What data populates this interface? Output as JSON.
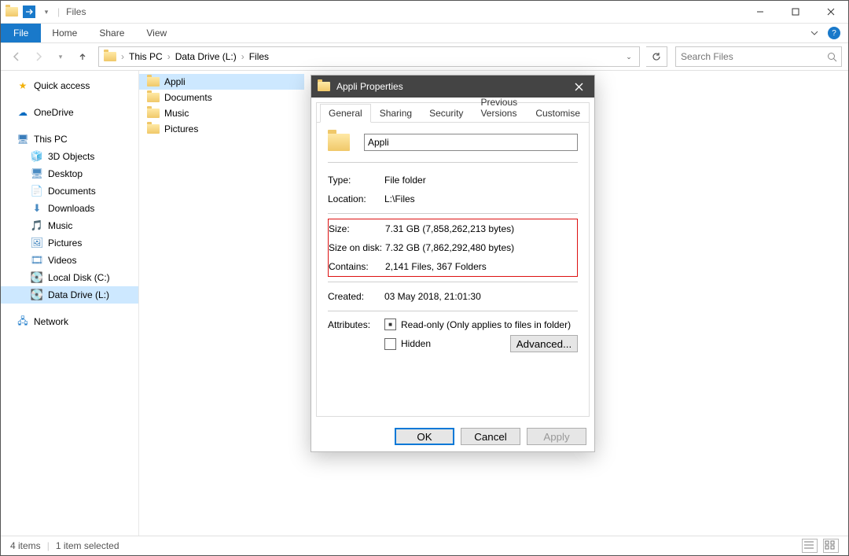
{
  "window": {
    "title": "Files"
  },
  "ribbon": {
    "file": "File",
    "tabs": [
      "Home",
      "Share",
      "View"
    ]
  },
  "breadcrumb": [
    "This PC",
    "Data Drive (L:)",
    "Files"
  ],
  "search": {
    "placeholder": "Search Files"
  },
  "sidebar": {
    "quick_access": "Quick access",
    "onedrive": "OneDrive",
    "this_pc": "This PC",
    "pc_children": [
      "3D Objects",
      "Desktop",
      "Documents",
      "Downloads",
      "Music",
      "Pictures",
      "Videos",
      "Local Disk (C:)",
      "Data Drive (L:)"
    ],
    "selected_child": "Data Drive (L:)",
    "network": "Network"
  },
  "files": {
    "items": [
      "Appli",
      "Documents",
      "Music",
      "Pictures"
    ],
    "selected": "Appli"
  },
  "status": {
    "count": "4 items",
    "selection": "1 item selected"
  },
  "dialog": {
    "title": "Appli Properties",
    "tabs": [
      "General",
      "Sharing",
      "Security",
      "Previous Versions",
      "Customise"
    ],
    "active_tab": "General",
    "name": "Appli",
    "type_label": "Type:",
    "type_value": "File folder",
    "location_label": "Location:",
    "location_value": "L:\\Files",
    "size_label": "Size:",
    "size_value": "7.31 GB (7,858,262,213 bytes)",
    "sizeondisk_label": "Size on disk:",
    "sizeondisk_value": "7.32 GB (7,862,292,480 bytes)",
    "contains_label": "Contains:",
    "contains_value": "2,141 Files, 367 Folders",
    "created_label": "Created:",
    "created_value": "03 May 2018, 21:01:30",
    "attributes_label": "Attributes:",
    "readonly_label": "Read-only (Only applies to files in folder)",
    "hidden_label": "Hidden",
    "advanced": "Advanced...",
    "ok": "OK",
    "cancel": "Cancel",
    "apply": "Apply"
  }
}
